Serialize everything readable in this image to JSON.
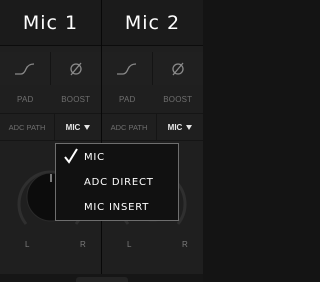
{
  "channels": [
    {
      "title": "Mic 1",
      "buttons": [
        {
          "icon": "highpass-filter-icon"
        },
        {
          "icon": "phase-invert-icon"
        }
      ],
      "labels": {
        "pad": "PAD",
        "boost": "BOOST"
      },
      "adc_path": {
        "label": "ADC PATH",
        "value": "MIC"
      },
      "pan": {
        "left": "L",
        "right": "R"
      }
    },
    {
      "title": "Mic 2",
      "buttons": [
        {
          "icon": "highpass-filter-icon"
        },
        {
          "icon": "phase-invert-icon"
        }
      ],
      "labels": {
        "pad": "PAD",
        "boost": "BOOST"
      },
      "adc_path": {
        "label": "ADC PATH",
        "value": "MIC"
      },
      "pan": {
        "left": "L",
        "right": "R"
      }
    }
  ],
  "dropdown": {
    "options": [
      "MIC",
      "ADC DIRECT",
      "MIC INSERT"
    ],
    "selected": "MIC"
  },
  "colors": {
    "background": "#1f1f1f",
    "title_text": "#ffffff",
    "label_text": "#6f6f6f",
    "menu_border": "#6e6e6e"
  }
}
